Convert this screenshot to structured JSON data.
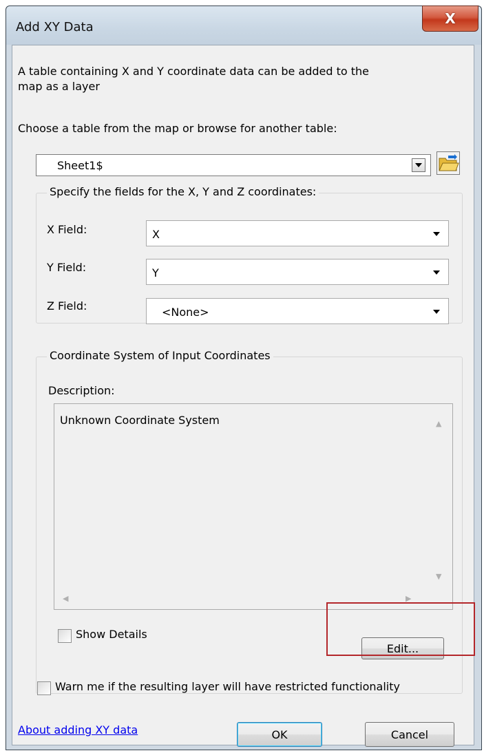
{
  "window": {
    "title": "Add XY Data",
    "close_glyph": "X"
  },
  "intro": {
    "line1": "A table containing X and Y coordinate data can be added to the",
    "line2": "map as a layer"
  },
  "table": {
    "prompt": "Choose a table from the map or browse for another table:",
    "selected": "Sheet1$"
  },
  "fields": {
    "group_title": "Specify the fields for the X, Y and Z coordinates:",
    "x_label": "X Field:",
    "x_value": "X",
    "y_label": "Y Field:",
    "y_value": "Y",
    "z_label": "Z Field:",
    "z_value": "<None>"
  },
  "coordinate_system": {
    "group_title": "Coordinate System of Input Coordinates",
    "description_label": "Description:",
    "description_text": "Unknown Coordinate System",
    "show_details_label": "Show Details",
    "show_details_checked": false,
    "edit_label": "Edit..."
  },
  "warn": {
    "label": "Warn me if the resulting layer will have restricted functionality",
    "checked": false
  },
  "footer": {
    "help_link": "About adding XY data",
    "ok_label": "OK",
    "cancel_label": "Cancel"
  },
  "colors": {
    "highlight": "#b3262a",
    "close_button": "#c3381c",
    "link": "#0000ee"
  }
}
